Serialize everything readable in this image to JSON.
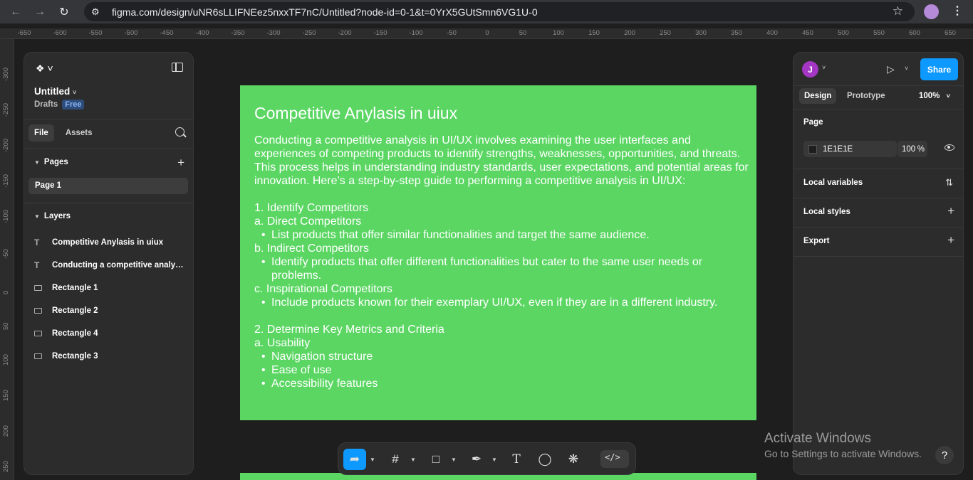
{
  "browser": {
    "url": "figma.com/design/uNR6sLLIFNEez5nxxTF7nC/Untitled?node-id=0-1&t=0YrX5GUtSmn6VG1U-0"
  },
  "ruler": {
    "top_labels": [
      "-650",
      "-600",
      "-550",
      "-500",
      "-450",
      "-400",
      "-350",
      "-300",
      "-250",
      "-200",
      "-150",
      "-100",
      "-50",
      "0",
      "50",
      "100",
      "150",
      "200",
      "250",
      "300",
      "350",
      "400",
      "450",
      "500",
      "550",
      "600",
      "650"
    ],
    "left_labels": [
      "-300",
      "-250",
      "-200",
      "-150",
      "-100",
      "-50",
      "0",
      "50",
      "100",
      "150",
      "200",
      "250"
    ]
  },
  "left_panel": {
    "file_name": "Untitled",
    "location": "Drafts",
    "plan_badge": "Free",
    "tabs": [
      "File",
      "Assets"
    ],
    "pages_heading": "Pages",
    "pages": [
      "Page 1"
    ],
    "layers_heading": "Layers",
    "layers": [
      {
        "type": "text",
        "label": "Competitive Anylasis in uiux"
      },
      {
        "type": "text",
        "label": "Conducting a competitive analysis..."
      },
      {
        "type": "rect",
        "label": "Rectangle 1"
      },
      {
        "type": "rect",
        "label": "Rectangle 2"
      },
      {
        "type": "rect",
        "label": "Rectangle 4"
      },
      {
        "type": "rect",
        "label": "Rectangle 3"
      }
    ]
  },
  "canvas": {
    "frame_color": "#5bd663",
    "title": "Competitive Anylasis in uiux",
    "intro": "Conducting a competitive analysis in UI/UX involves examining the user interfaces and experiences of competing products to identify strengths, weaknesses, opportunities, and threats. This process helps in understanding industry standards, user expectations, and potential areas for innovation. Here’s a step-by-step guide to performing a competitive analysis in UI/UX:",
    "step1": "1. Identify Competitors",
    "a_direct": "a. Direct Competitors",
    "a_direct_bullet": "List products that offer similar functionalities and target the same audience.",
    "b_indirect": "b. Indirect Competitors",
    "b_indirect_bullet": "Identify products that offer different functionalities but cater to the same user needs or problems.",
    "c_inspirational": "c. Inspirational Competitors",
    "c_inspirational_bullet": "Include products known for their exemplary UI/UX, even if they are in a different industry.",
    "step2": "2. Determine Key Metrics and Criteria",
    "a_usability": "a. Usability",
    "usability_bullets": [
      "Navigation structure",
      "Ease of use",
      "Accessibility features"
    ]
  },
  "right_panel": {
    "avatar_initial": "J",
    "share_label": "Share",
    "tabs": [
      "Design",
      "Prototype"
    ],
    "zoom": "100%",
    "page_heading": "Page",
    "page_color": "1E1E1E",
    "page_opacity": "100",
    "opacity_unit": "%",
    "local_variables": "Local variables",
    "local_styles": "Local styles",
    "export": "Export"
  },
  "toolbar": {
    "accent": "#0d99ff",
    "tools": [
      "move",
      "frame",
      "rectangle",
      "pen",
      "text",
      "comment",
      "actions",
      "dev-mode"
    ]
  },
  "watermark": {
    "line1": "Activate Windows",
    "line2": "Go to Settings to activate Windows."
  },
  "help_label": "?"
}
